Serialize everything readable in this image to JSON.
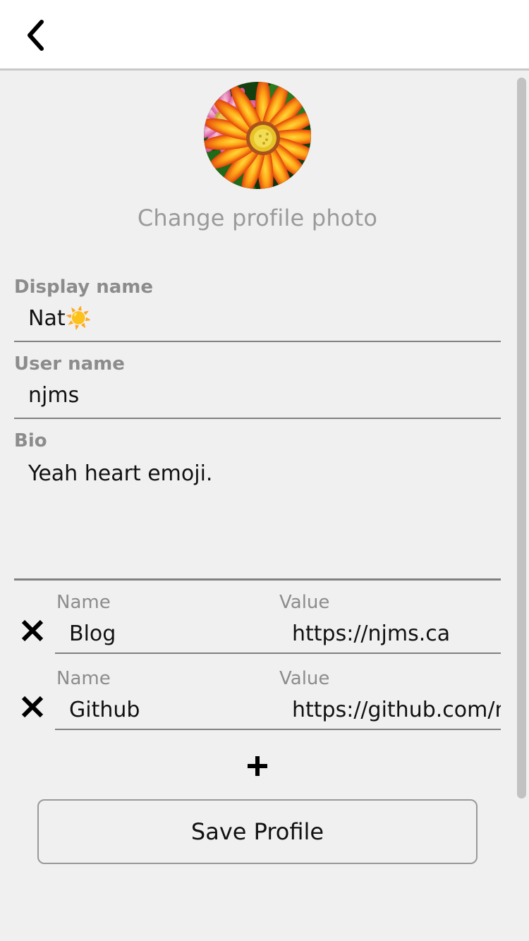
{
  "header": {
    "back_icon": "chevron-left-icon"
  },
  "profile": {
    "avatar_alt": "flower-avatar",
    "change_photo_label": "Change profile photo",
    "fields": [
      {
        "label": "Display name",
        "value": "Nat☀️",
        "placeholder": "Display name"
      },
      {
        "label": "User name",
        "value": "njms",
        "placeholder": "User name"
      },
      {
        "label": "Bio",
        "value": "Yeah heart emoji.",
        "placeholder": "Bio"
      }
    ]
  },
  "links": {
    "name_label": "Name",
    "value_label": "Value",
    "delete_icon": "close-icon",
    "add_icon": "plus-icon",
    "rows": [
      {
        "name": "Blog",
        "value": "https://njms.ca"
      },
      {
        "name": "Github",
        "value": "https://github.com/na"
      }
    ]
  },
  "actions": {
    "save_label": "Save Profile"
  },
  "colors": {
    "page_background": "#ffffff",
    "content_background": "#f0f0f0",
    "label_gray": "#8c8c8c",
    "placeholder_gray": "#9a9a9a",
    "underline_gray": "#808080",
    "scrollbar_thumb": "#c2c2c2",
    "accent_orange": "#f5a623",
    "text_black": "#111111"
  }
}
